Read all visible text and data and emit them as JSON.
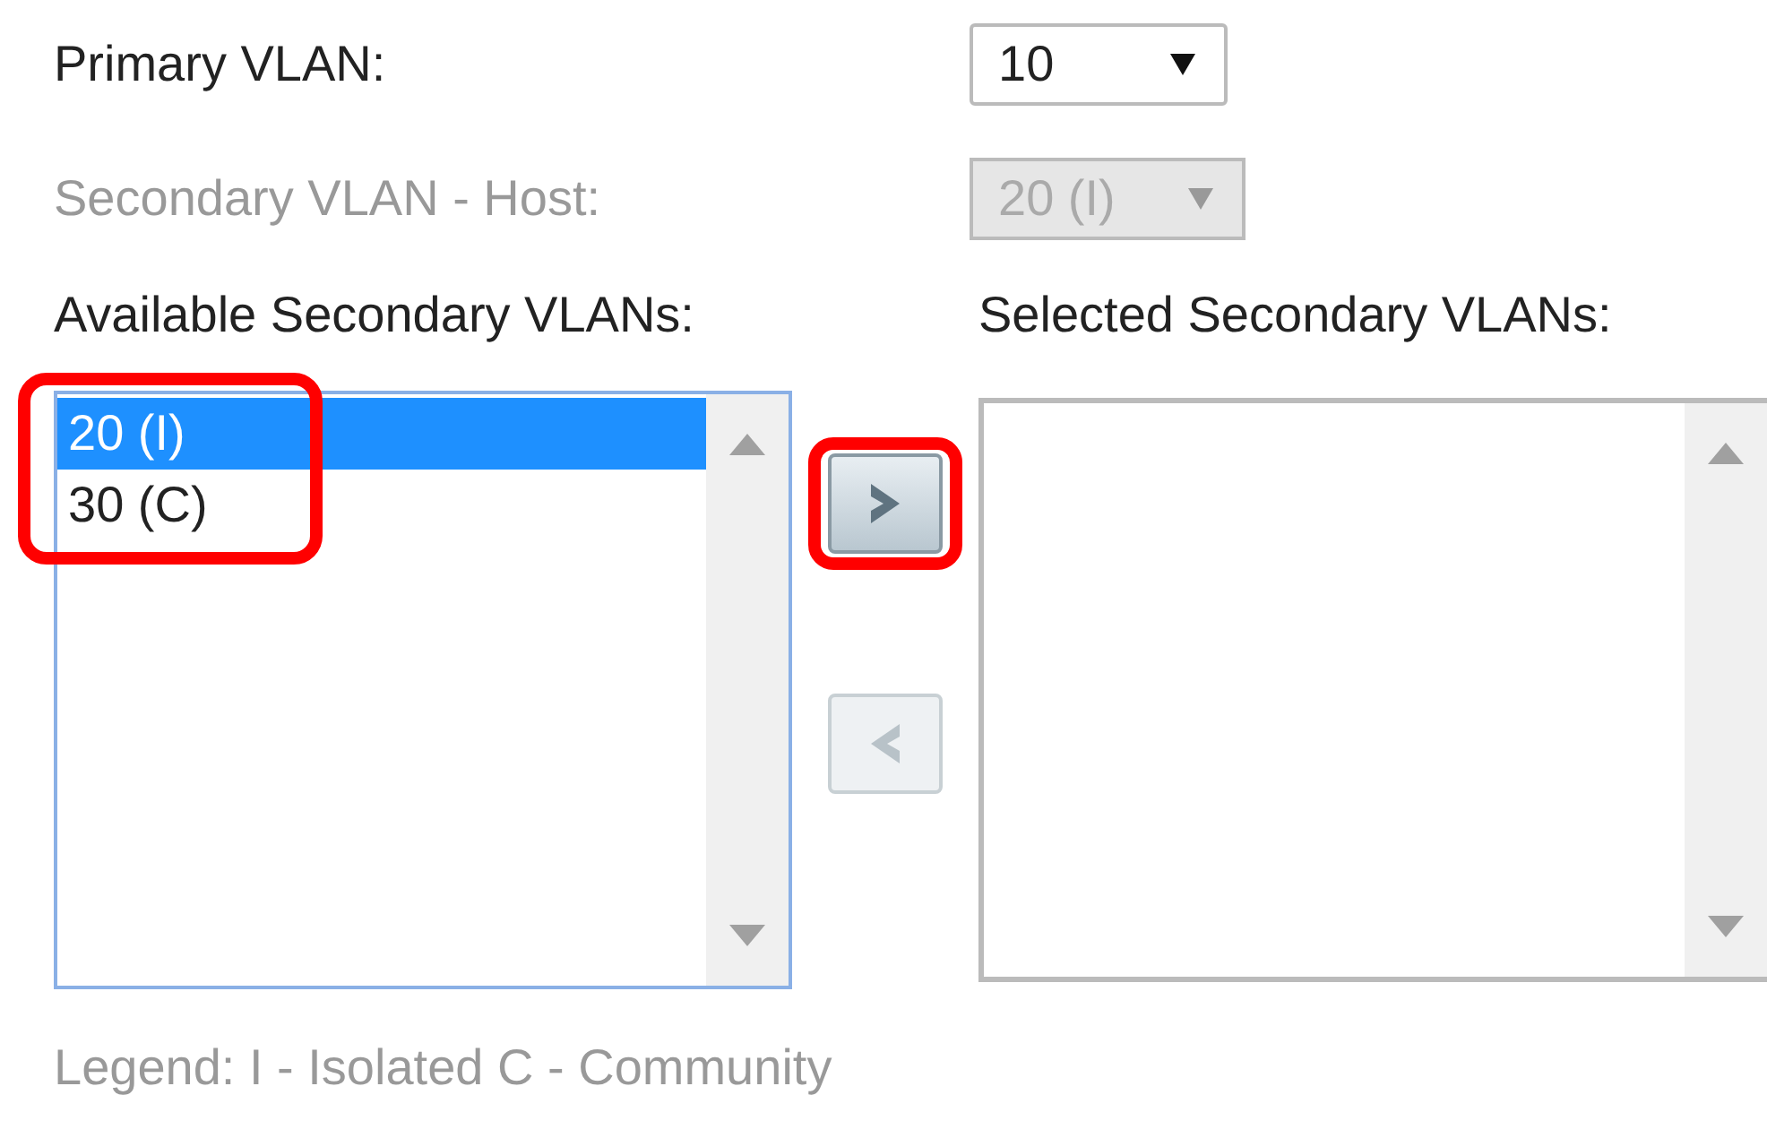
{
  "fields": [
    {
      "label": "Primary VLAN:",
      "value": "10",
      "disabled": false
    },
    {
      "label": "Secondary VLAN - Host:",
      "value": "20 (I)",
      "disabled": true
    }
  ],
  "available": {
    "label": "Available Secondary VLANs:",
    "highlighted": true,
    "items": [
      {
        "text": "20 (I)",
        "selected": true
      },
      {
        "text": "30 (C)",
        "selected": false
      }
    ]
  },
  "move_buttons": [
    {
      "kind": "add",
      "disabled": false,
      "highlighted": true
    },
    {
      "kind": "remove",
      "disabled": true,
      "highlighted": false
    }
  ],
  "selected": {
    "label": "Selected Secondary VLANs:"
  },
  "legend": "Legend: I - Isolated C - Community"
}
